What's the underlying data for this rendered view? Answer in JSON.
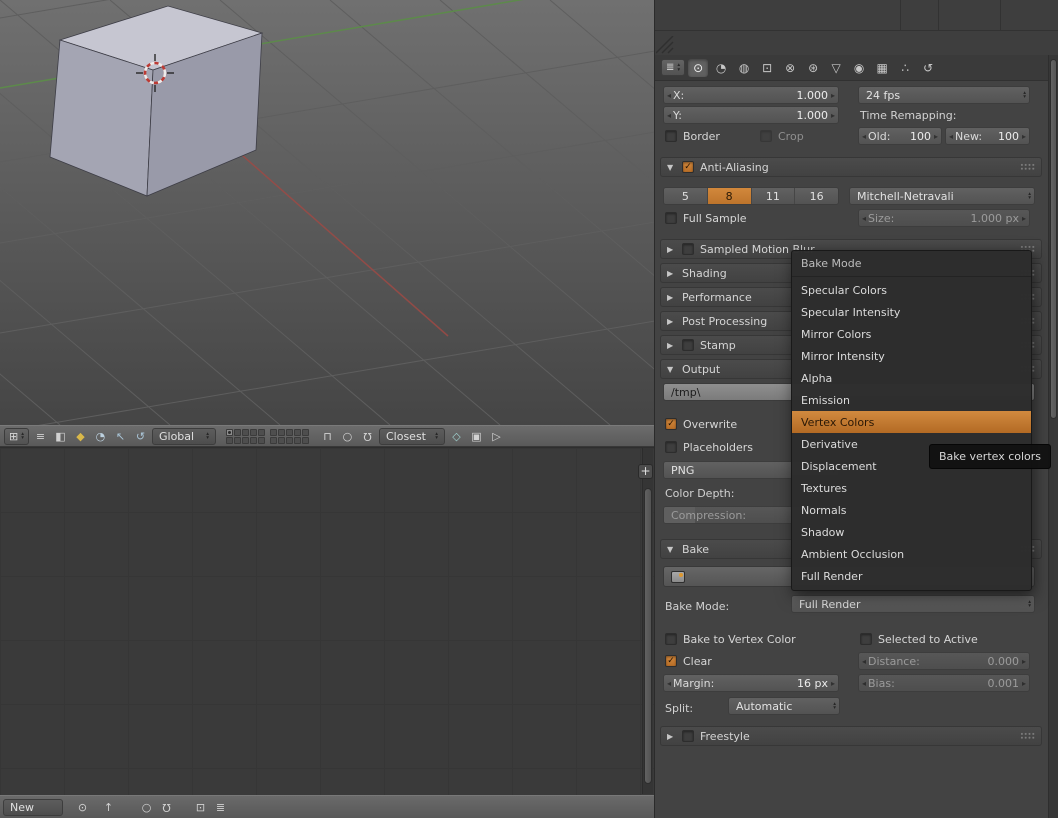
{
  "colors": {
    "accent": "#c9802f",
    "panel_bg": "#434343",
    "menu_bg": "#2d2d2d"
  },
  "viewport_header": {
    "orientation": "Global",
    "snap_target": "Closest"
  },
  "image_editor_header": {
    "datablock": "New"
  },
  "render_props": {
    "dimensions": {
      "x_label": "X:",
      "x_value": "1.000",
      "y_label": "Y:",
      "y_value": "1.000",
      "border": "Border",
      "crop": "Crop",
      "fps": "24 fps",
      "time_remapping": "Time Remapping:",
      "old_label": "Old:",
      "old_value": "100",
      "new_label": "New:",
      "new_value": "100"
    },
    "anti_aliasing": {
      "title": "Anti-Aliasing",
      "samples": [
        "5",
        "8",
        "11",
        "16"
      ],
      "selected_sample": "8",
      "filter": "Mitchell-Netravali",
      "full_sample": "Full Sample",
      "size_label": "Size:",
      "size_value": "1.000 px"
    },
    "panels": {
      "sampled_motion_blur": "Sampled Motion Blur",
      "shading": "Shading",
      "performance": "Performance",
      "post_processing": "Post Processing",
      "stamp": "Stamp",
      "output": "Output",
      "bake": "Bake",
      "freestyle": "Freestyle"
    },
    "output": {
      "path": "/tmp\\",
      "overwrite": "Overwrite",
      "placeholders": "Placeholders",
      "format": "PNG",
      "color_depth": "Color Depth:",
      "compression": "Compression:"
    },
    "bake": {
      "mode_label": "Bake Mode:",
      "mode_value": "Full Render",
      "bake_to_vertex": "Bake to Vertex Color",
      "selected_to_active": "Selected to Active",
      "clear": "Clear",
      "distance_label": "Distance:",
      "distance_value": "0.000",
      "margin_label": "Margin:",
      "margin_value": "16 px",
      "bias_label": "Bias:",
      "bias_value": "0.001",
      "split_label": "Split:",
      "split_value": "Automatic"
    }
  },
  "menu": {
    "title": "Bake Mode",
    "items": [
      "Specular Colors",
      "Specular Intensity",
      "Mirror Colors",
      "Mirror Intensity",
      "Alpha",
      "Emission",
      "Vertex Colors",
      "Derivative",
      "Displacement",
      "Textures",
      "Normals",
      "Shadow",
      "Ambient Occlusion",
      "Full Render"
    ],
    "selected": "Vertex Colors"
  },
  "tooltip": "Bake vertex colors"
}
